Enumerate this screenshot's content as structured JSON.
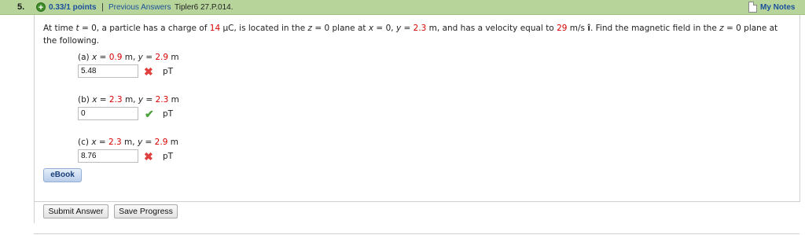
{
  "header": {
    "question_number": "5.",
    "points": "0.33/1 points",
    "separator": "|",
    "previous_answers": "Previous Answers",
    "problem_id": "Tipler6 27.P.014.",
    "my_notes": "My Notes"
  },
  "problem": {
    "t1": "At time ",
    "t_var": "t",
    "t2": " = 0, a particle has a charge of ",
    "charge": "14",
    "t3": " μC, is located in the ",
    "z_var": "z",
    "t4": " = 0 plane at ",
    "x_var": "x",
    "t5": " = 0, ",
    "y_var": "y",
    "t6": " = ",
    "y_val": "2.3",
    "t7": " m, and has a velocity equal to ",
    "velocity": "29",
    "t8": " m/s ",
    "i_hat": "î",
    "t9": ". Find the magnetic field in the ",
    "z_var2": "z",
    "t10": " = 0 plane at the following."
  },
  "parts": [
    {
      "label": "(a)",
      "x": "0.9",
      "y": "2.9",
      "value": "5.48",
      "unit": "pT",
      "status": "incorrect"
    },
    {
      "label": "(b)",
      "x": "2.3",
      "y": "2.3",
      "value": "0",
      "unit": "pT",
      "status": "correct"
    },
    {
      "label": "(c)",
      "x": "2.3",
      "y": "2.9",
      "value": "8.76",
      "unit": "pT",
      "status": "incorrect"
    }
  ],
  "common": {
    "x_name": "x",
    "y_name": "y",
    "eq": " = ",
    "m": " m, ",
    "m_end": " m"
  },
  "icons": {
    "incorrect": "✖",
    "correct": "✔",
    "plus": "+"
  },
  "buttons": {
    "ebook": "eBook",
    "submit": "Submit Answer",
    "save": "Save Progress"
  },
  "colors": {
    "header_bg": "#b7d59b",
    "link": "#1a4f9c",
    "given_value": "#d60000",
    "incorrect": "#e04040",
    "correct": "#4ea33e"
  }
}
